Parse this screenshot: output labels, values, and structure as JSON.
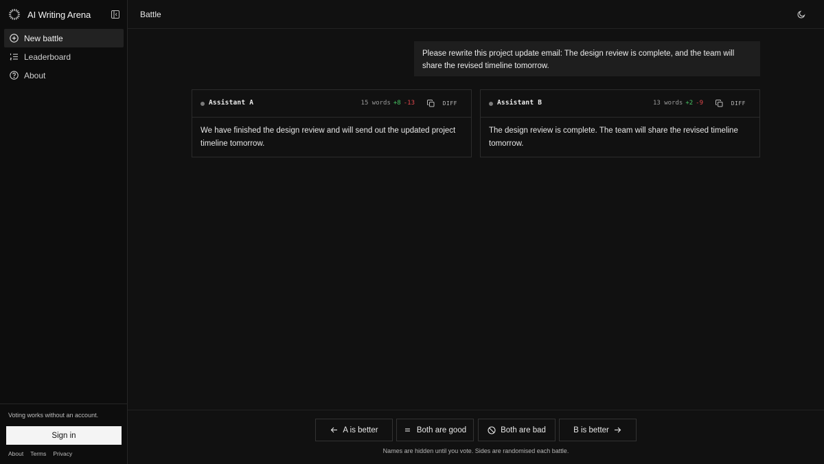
{
  "app": {
    "title": "AI Writing Arena",
    "logo_icon": "sparkle-ring-icon",
    "collapse_icon": "sidebar-collapse-icon"
  },
  "sidebar": {
    "items": [
      {
        "label": "New battle",
        "icon": "plus-circle-icon",
        "active": true
      },
      {
        "label": "Leaderboard",
        "icon": "list-ordered-icon",
        "active": false
      },
      {
        "label": "About",
        "icon": "help-circle-icon",
        "active": false
      }
    ],
    "footer": {
      "note": "Voting works without an account.",
      "signin_label": "Sign in",
      "links": [
        "About",
        "Terms",
        "Privacy"
      ]
    }
  },
  "header": {
    "breadcrumb": "Battle",
    "theme_icon": "moon-icon"
  },
  "prompt": {
    "text": "Please rewrite this project update email: The design review is complete, and the team will share the revised timeline tomorrow."
  },
  "responses": [
    {
      "name": "Assistant A",
      "words": "15 words",
      "added": "+8",
      "removed": "-13",
      "diff_label": "DIFF",
      "text": "We have finished the design review and will send out the updated project timeline tomorrow."
    },
    {
      "name": "Assistant B",
      "words": "13 words",
      "added": "+2",
      "removed": "-9",
      "diff_label": "DIFF",
      "text": "The design review is complete. The team will share the revised timeline tomorrow."
    }
  ],
  "vote": {
    "a_better": "A is better",
    "both_good": "Both are good",
    "both_bad": "Both are bad",
    "b_better": "B is better",
    "hint": "Names are hidden until you vote. Sides are randomised each battle."
  },
  "colors": {
    "background": "#111111",
    "sidebar": "#0d0d0d",
    "added": "#47c463",
    "removed": "#e5484d",
    "accent_button": "#f4f4f4"
  }
}
